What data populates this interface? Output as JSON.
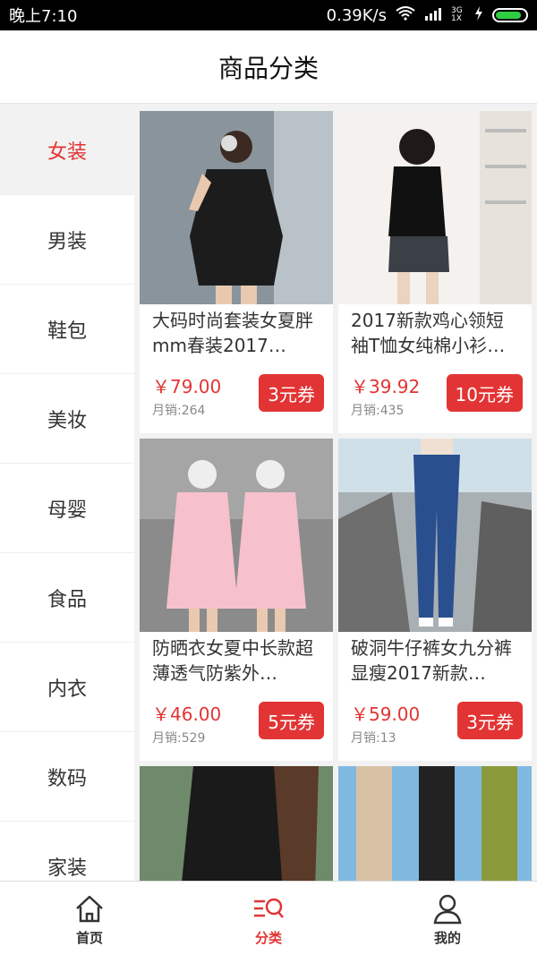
{
  "status": {
    "time": "晚上7:10",
    "network_speed": "0.39K/s",
    "sim_labels": "3G 1X"
  },
  "header": {
    "title": "商品分类"
  },
  "sidebar": {
    "items": [
      {
        "label": "女装",
        "active": true
      },
      {
        "label": "男装"
      },
      {
        "label": "鞋包"
      },
      {
        "label": "美妆"
      },
      {
        "label": "母婴"
      },
      {
        "label": "食品"
      },
      {
        "label": "内衣"
      },
      {
        "label": "数码"
      },
      {
        "label": "家装"
      }
    ]
  },
  "products": [
    {
      "title": "大码时尚套装女夏胖mm春装2017…",
      "price": "￥79.00",
      "sales": "月销:264",
      "coupon": "3元券"
    },
    {
      "title": "2017新款鸡心领短袖T恤女纯棉小衫…",
      "price": "￥39.92",
      "sales": "月销:435",
      "coupon": "10元券"
    },
    {
      "title": "防晒衣女夏中长款超薄透气防紫外…",
      "price": "￥46.00",
      "sales": "月销:529",
      "coupon": "5元券"
    },
    {
      "title": "破洞牛仔裤女九分裤显瘦2017新款…",
      "price": "￥59.00",
      "sales": "月销:13",
      "coupon": "3元券"
    }
  ],
  "tabbar": {
    "items": [
      {
        "label": "首页",
        "icon": "home-icon"
      },
      {
        "label": "分类",
        "icon": "category-search-icon",
        "active": true
      },
      {
        "label": "我的",
        "icon": "user-icon"
      }
    ]
  },
  "colors": {
    "accent": "#e23434",
    "background": "#f2f2f2"
  }
}
